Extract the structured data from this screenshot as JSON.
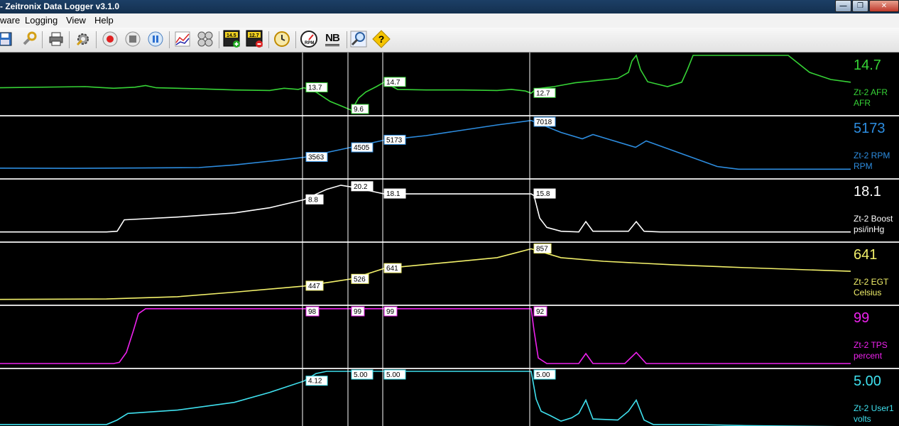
{
  "window": {
    "title": "- Zeitronix Data Logger v3.1.0"
  },
  "menu": [
    {
      "id": "firmware",
      "label": "ware"
    },
    {
      "id": "logging",
      "label": "Logging"
    },
    {
      "id": "view",
      "label": "View"
    },
    {
      "id": "help",
      "label": "Help"
    }
  ],
  "toolbar": {
    "afr_low_badge": "14.5",
    "afr_high_badge": "12.7",
    "gauge_badge": "RPM",
    "nb_badge": "NB"
  },
  "colors": {
    "afr": "#36d336",
    "rpm": "#2d8de0",
    "boost": "#ffffff",
    "egt": "#f2f06a",
    "tps": "#ee22ee",
    "user1": "#3fe0ee"
  },
  "chart_data": [
    {
      "type": "line",
      "series": [
        {
          "name": "Zt-2 AFR",
          "unit": "AFR",
          "current": "14.7",
          "x": [
            0,
            120,
            160,
            190,
            205,
            220,
            280,
            330,
            380,
            400,
            420,
            428,
            445,
            465,
            480,
            495,
            505,
            515,
            530,
            541,
            560,
            600,
            650,
            700,
            720,
            740,
            748,
            755,
            780,
            810,
            840,
            870,
            885,
            890,
            896,
            902,
            912,
            940,
            960,
            968,
            976,
            1000,
            1050,
            1110,
            1140,
            1170,
            1198
          ],
          "y": [
            13.7,
            13.9,
            13.6,
            13.8,
            14.1,
            13.7,
            13.5,
            13.3,
            13.2,
            13.6,
            13.4,
            13.7,
            12.9,
            11.2,
            10.4,
            9.6,
            11.8,
            12.9,
            13.9,
            14.7,
            13.4,
            13.3,
            13.3,
            13.2,
            13.4,
            13.1,
            12.7,
            13.5,
            13.9,
            14.6,
            15.0,
            15.4,
            16.5,
            18.6,
            19.6,
            17.0,
            14.8,
            13.9,
            14.7,
            17.0,
            19.6,
            19.6,
            19.6,
            19.6,
            16.5,
            15.2,
            14.7
          ]
        }
      ],
      "point_labels": [
        "13.7",
        "9.6",
        "14.7",
        "12.7"
      ],
      "ylim": [
        9.5,
        19.6
      ]
    },
    {
      "type": "line",
      "series": [
        {
          "name": "Zt-2 RPM",
          "unit": "RPM",
          "current": "5173",
          "x": [
            0,
            100,
            200,
            280,
            330,
            380,
            428,
            495,
            541,
            600,
            650,
            700,
            748,
            760,
            790,
            820,
            835,
            860,
            895,
            910,
            960,
            1010,
            1040,
            1100,
            1198
          ],
          "y": [
            2550,
            2530,
            2560,
            2600,
            2850,
            3200,
            3563,
            4505,
            5173,
            5600,
            6100,
            6600,
            7018,
            6700,
            5900,
            5300,
            5700,
            5200,
            4500,
            5100,
            3900,
            2700,
            2450,
            2450,
            2450
          ],
          "labels": [
            "3563",
            "4505",
            "5173",
            "7018"
          ]
        }
      ],
      "point_labels": [
        "3563",
        "4505",
        "5173",
        "7018"
      ],
      "ylim": [
        2000,
        7200
      ]
    },
    {
      "type": "line",
      "series": [
        {
          "name": "Zt-2 Boost",
          "unit": "psi/inHg",
          "current": "18.1",
          "x": [
            0,
            150,
            165,
            175,
            250,
            330,
            380,
            428,
            460,
            480,
            495,
            541,
            620,
            700,
            748,
            752,
            760,
            770,
            790,
            815,
            825,
            835,
            860,
            885,
            896,
            907,
            930,
            980,
            1050,
            1198
          ],
          "y": [
            -11.5,
            -11.5,
            -11.3,
            -8.0,
            -7.2,
            -6.0,
            -4.5,
            -2.2,
            0.8,
            2.0,
            1.5,
            -0.5,
            -0.5,
            -0.5,
            -0.5,
            -1.0,
            -7.5,
            -10.2,
            -11.3,
            -11.5,
            -8.5,
            -11.3,
            -11.3,
            -11.3,
            -8.5,
            -11.3,
            -11.5,
            -11.5,
            -11.5,
            -11.5
          ],
          "labels": [
            "8.8",
            "20.2",
            "18.1",
            "15.8"
          ]
        }
      ],
      "point_labels": [
        "8.8",
        "20.2",
        "18.1",
        "15.8"
      ],
      "ylim": [
        -13,
        3
      ]
    },
    {
      "type": "line",
      "series": [
        {
          "name": "Zt-2 EGT",
          "unit": "Celsius",
          "current": "641",
          "x": [
            0,
            150,
            250,
            330,
            428,
            495,
            541,
            620,
            700,
            748,
            790,
            850,
            950,
            1050,
            1198
          ],
          "y": [
            300,
            305,
            330,
            380,
            447,
            526,
            641,
            700,
            760,
            857,
            760,
            720,
            680,
            650,
            610
          ]
        }
      ],
      "point_labels": [
        "447",
        "526",
        "641",
        "857"
      ],
      "ylim": [
        290,
        900
      ]
    },
    {
      "type": "line",
      "series": [
        {
          "name": "Zt-2 TPS",
          "unit": "percent",
          "current": "99",
          "x": [
            0,
            160,
            168,
            178,
            188,
            195,
            205,
            300,
            428,
            495,
            541,
            700,
            748,
            752,
            758,
            770,
            815,
            825,
            835,
            880,
            896,
            910,
            960,
            1100,
            1198
          ],
          "y": [
            0,
            0,
            2,
            20,
            60,
            90,
            99,
            99,
            99,
            99,
            99,
            99,
            99,
            60,
            10,
            0,
            0,
            18,
            0,
            0,
            20,
            0,
            0,
            0,
            0
          ]
        }
      ],
      "point_labels": [
        "98",
        "99",
        "99",
        "92"
      ],
      "ylim": [
        0,
        100
      ]
    },
    {
      "type": "line",
      "series": [
        {
          "name": "Zt-2 User1",
          "unit": "volts",
          "current": "5.00",
          "x": [
            0,
            150,
            165,
            180,
            250,
            330,
            380,
            428,
            445,
            460,
            495,
            541,
            620,
            700,
            748,
            755,
            762,
            775,
            790,
            805,
            815,
            825,
            835,
            870,
            885,
            896,
            907,
            920,
            980,
            1050,
            1198
          ],
          "y": [
            0.2,
            0.2,
            0.6,
            1.2,
            1.5,
            2.2,
            3.1,
            4.12,
            4.8,
            5.0,
            5.0,
            5.0,
            5.0,
            5.0,
            5.0,
            2.5,
            1.4,
            1.0,
            0.5,
            0.8,
            1.2,
            2.4,
            0.7,
            0.6,
            1.4,
            2.4,
            0.6,
            0.2,
            0.2,
            0.1,
            0.0
          ]
        }
      ],
      "point_labels": [
        "4.12",
        "5.00",
        "5.00",
        "5.00"
      ],
      "ylim": [
        0,
        5.0
      ]
    }
  ]
}
